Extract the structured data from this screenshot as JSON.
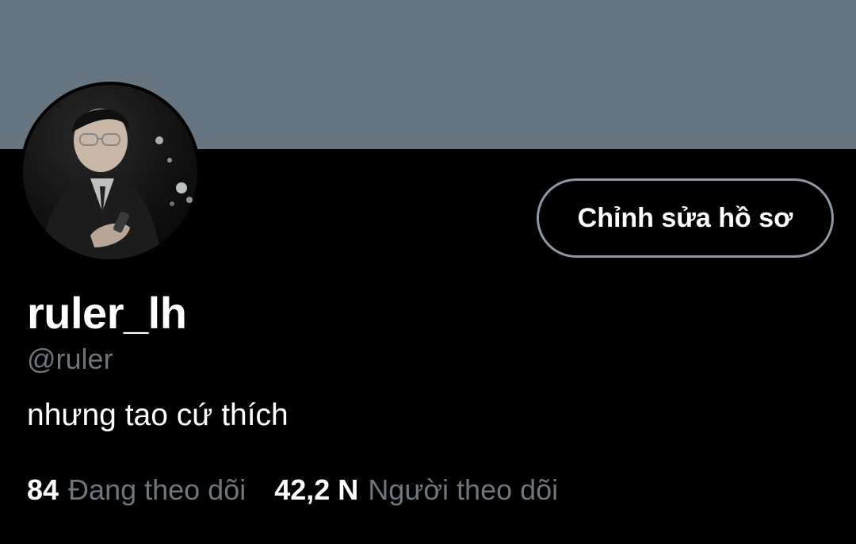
{
  "profile": {
    "display_name": "ruler_lh",
    "handle": "@ruler",
    "bio": "nhưng tao cứ thích",
    "edit_button_label": "Chỉnh sửa hồ sơ",
    "avatar_icon": "user-avatar-photo"
  },
  "stats": {
    "following_count": "84",
    "following_label": "Đang theo dõi",
    "followers_count": "42,2 N",
    "followers_label": "Người theo dõi"
  },
  "colors": {
    "background": "#000000",
    "banner": "#66757f",
    "primary_text": "#ffffff",
    "secondary_text": "#6e767d",
    "button_border": "#8b98a5"
  }
}
